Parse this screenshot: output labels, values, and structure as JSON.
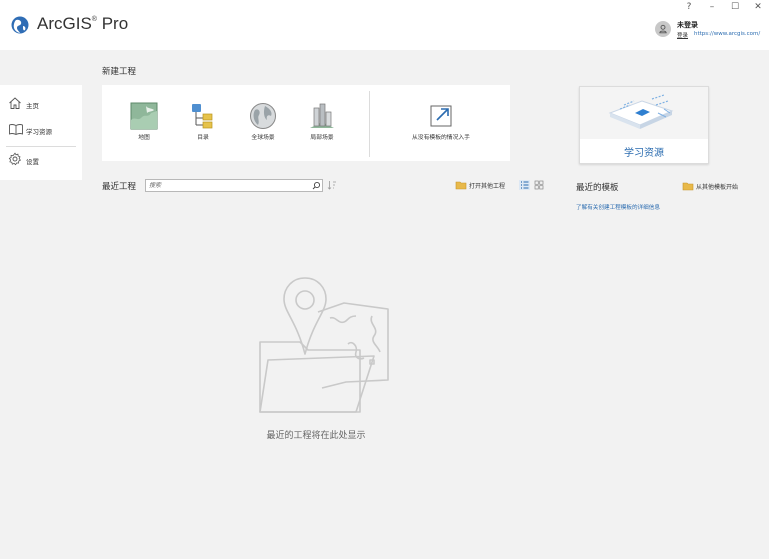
{
  "app": {
    "brand_name": "ArcGIS",
    "brand_suffix": "Pro",
    "registered_mark": "®"
  },
  "window_controls": {
    "help": "?",
    "minimize": "–",
    "maximize": "☐",
    "close": "✕"
  },
  "user": {
    "status": "未登录",
    "signin_label": "登录",
    "portal_url": "https://www.arcgis.com/"
  },
  "sidebar": {
    "items": [
      {
        "label": "主页",
        "icon": "home-icon"
      },
      {
        "label": "学习资源",
        "icon": "book-icon"
      },
      {
        "label": "设置",
        "icon": "gear-icon"
      }
    ]
  },
  "new_project": {
    "title": "新建工程",
    "items": [
      {
        "label": "地图",
        "icon": "map-icon"
      },
      {
        "label": "目录",
        "icon": "catalog-icon"
      },
      {
        "label": "全球场景",
        "icon": "globe-icon"
      },
      {
        "label": "局部场景",
        "icon": "local-scene-icon"
      },
      {
        "label": "从没有模板的情况入手",
        "icon": "start-without-template-icon"
      }
    ]
  },
  "learning": {
    "label": "学习资源"
  },
  "recent": {
    "title": "最近工程",
    "search_placeholder": "搜索",
    "open_other_label": "打开其他工程",
    "empty_message": "最近的工程将在此处显示"
  },
  "templates": {
    "title": "最近的模板",
    "start_from_other_label": "从其他模板开始",
    "learn_more_link": "了解有关创建工程模板的详细信息"
  },
  "colors": {
    "accent": "#2b6cb0",
    "folder": "#e8b94a",
    "background": "#f2f2f2"
  }
}
